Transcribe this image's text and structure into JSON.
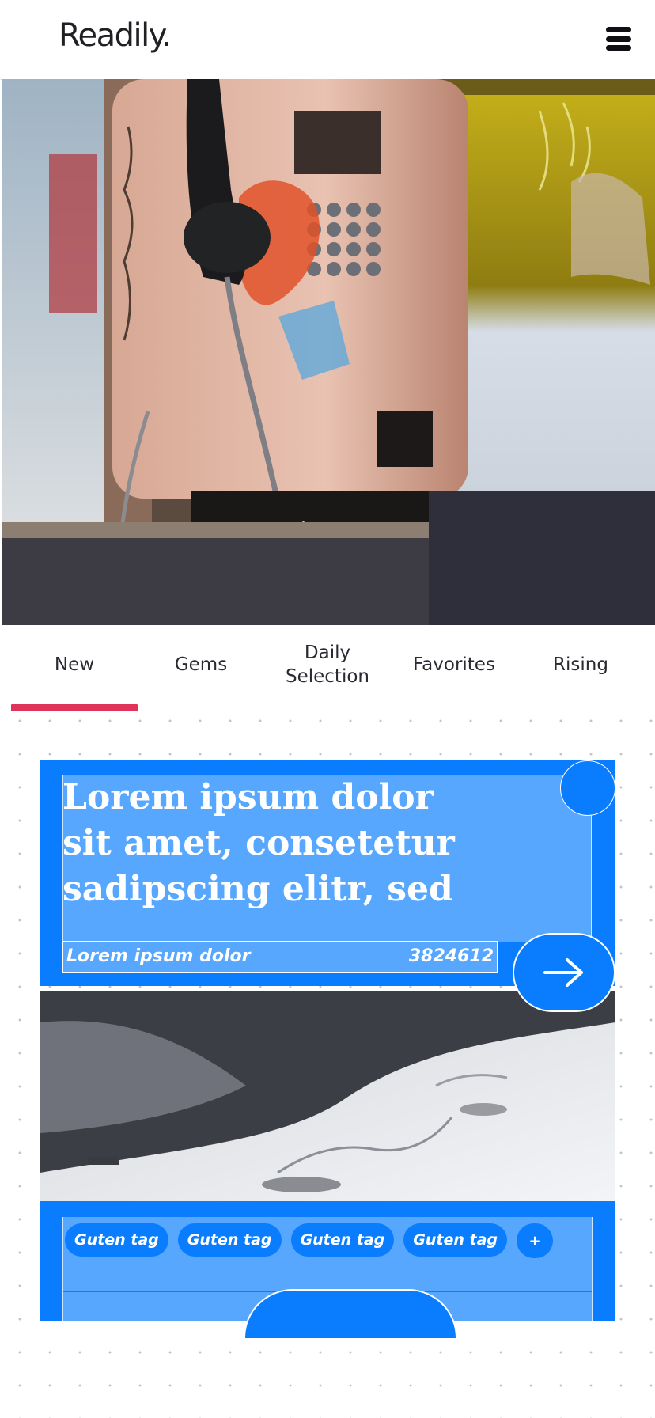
{
  "header": {
    "logo": "Readily.",
    "menu_icon": "hamburger-menu-icon"
  },
  "tabs": [
    {
      "label": "New",
      "active": true
    },
    {
      "label": "Gems",
      "active": false
    },
    {
      "label": "Daily Selection",
      "active": false
    },
    {
      "label": "Favorites",
      "active": false
    },
    {
      "label": "Rising",
      "active": false
    }
  ],
  "card": {
    "title": "Lorem ipsum dolor sit amet, consetetur sadipscing elitr, sed",
    "subtitle": "Lorem ipsum dolor",
    "count": "3824612",
    "arrow_icon": "arrow-right-icon",
    "tags": [
      "Guten tag",
      "Guten tag",
      "Guten tag",
      "Guten tag"
    ],
    "add_tag_label": "+"
  },
  "colors": {
    "accent": "#0a7dff",
    "accent_light": "#57a7ff",
    "tab_indicator": "#e0335a"
  }
}
